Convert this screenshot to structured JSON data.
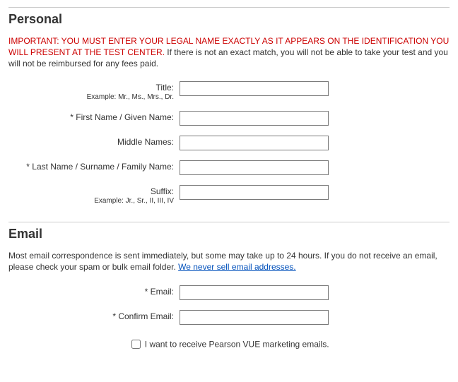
{
  "personal": {
    "heading": "Personal",
    "notice_red": "IMPORTANT: YOU MUST ENTER YOUR LEGAL NAME EXACTLY AS IT APPEARS ON THE IDENTIFICATION YOU WILL PRESENT AT THE TEST CENTER.",
    "notice_rest": " If there is not an exact match, you will not be able to take your test and you will not be reimbursed for any fees paid.",
    "fields": {
      "title": {
        "label": "Title:",
        "hint": "Example: Mr., Ms., Mrs., Dr.",
        "value": ""
      },
      "first_name": {
        "label": "* First Name / Given Name:",
        "value": ""
      },
      "middle_names": {
        "label": "Middle Names:",
        "value": ""
      },
      "last_name": {
        "label": "* Last Name / Surname / Family Name:",
        "value": ""
      },
      "suffix": {
        "label": "Suffix:",
        "hint": "Example: Jr., Sr., II, III, IV",
        "value": ""
      }
    }
  },
  "email": {
    "heading": "Email",
    "intro_text": "Most email correspondence is sent immediately, but some may take up to 24 hours. If you do not receive an email, please check your spam or bulk email folder. ",
    "intro_link": "We never sell email addresses.",
    "fields": {
      "email": {
        "label": "* Email:",
        "value": ""
      },
      "confirm_email": {
        "label": "* Confirm Email:",
        "value": ""
      }
    },
    "marketing_label": "I want to receive Pearson VUE marketing emails."
  }
}
